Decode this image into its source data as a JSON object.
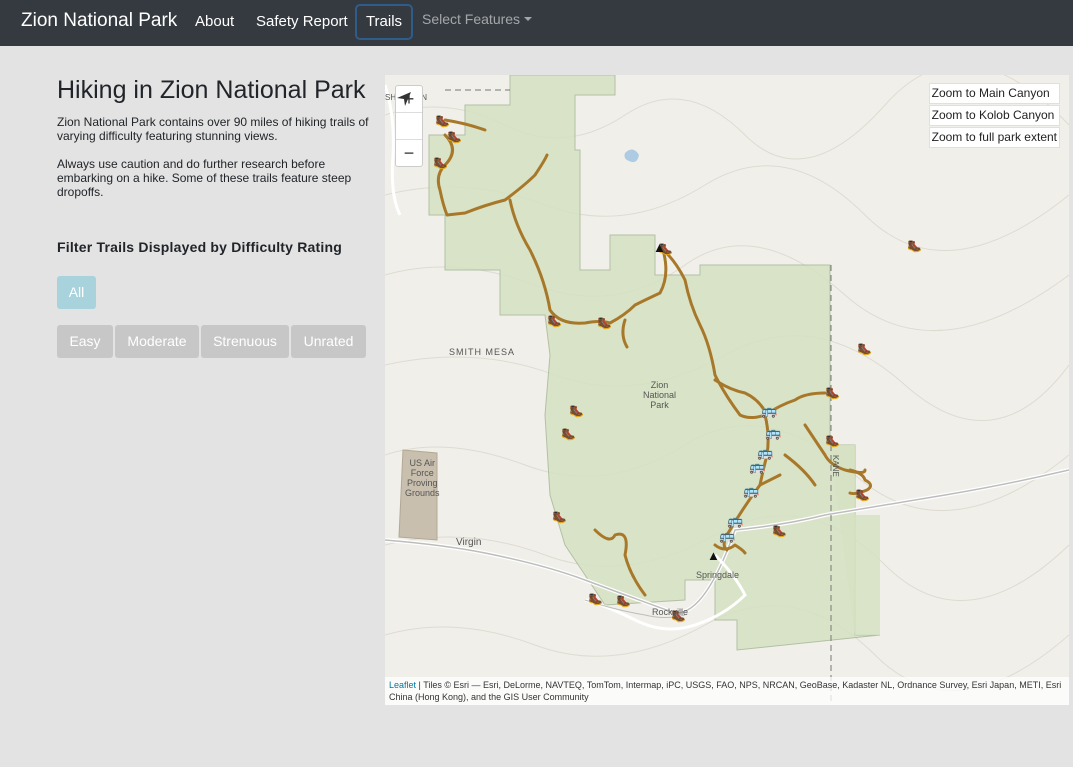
{
  "navbar": {
    "brand": "Zion National Park",
    "links": [
      "About",
      "Safety Report"
    ],
    "active": "Trails",
    "dropdown": "Select Features"
  },
  "sidebar": {
    "title": "Hiking in Zion National Park",
    "paragraph1": "Zion National Park contains over 90 miles of hiking trails of varying difficulty featuring stunning views.",
    "paragraph2": "Always use caution and do further research before embarking on a hike. Some of these trails feature steep dropoffs.",
    "filter_title": "Filter Trails Displayed by Difficulty Rating",
    "buttons": {
      "all": "All",
      "easy": "Easy",
      "moderate": "Moderate",
      "strenuous": "Strenuous",
      "unrated": "Unrated"
    }
  },
  "map": {
    "zoom_in": "+",
    "zoom_out": "−",
    "zoom_links": [
      "Zoom to Main Canyon",
      "Zoom to Kolob Canyon",
      "Zoom to full park extent"
    ],
    "labels": {
      "smith_mesa": "SMITH MESA",
      "zion": "Zion\nNational\nPark",
      "usaf": "US Air\nForce\nProving\nGrounds",
      "virgin": "Virgin",
      "springdale": "Springdale",
      "rockville": "Rockville",
      "kane": "KANE",
      "top_left": "SHINGTON"
    },
    "attribution_link": "Leaflet",
    "attribution_text": " | Tiles © Esri — Esri, DeLorme, NAVTEQ, TomTom, Intermap, iPC, USGS, FAO, NPS, NRCAN, GeoBase, Kadaster NL, Ordnance Survey, Esri Japan, METI, Esri China (Hong Kong), and the GIS User Community",
    "colors": {
      "trail": "#a8782a",
      "park": "#d6e3c4",
      "terrain": "#f0efe9"
    }
  }
}
